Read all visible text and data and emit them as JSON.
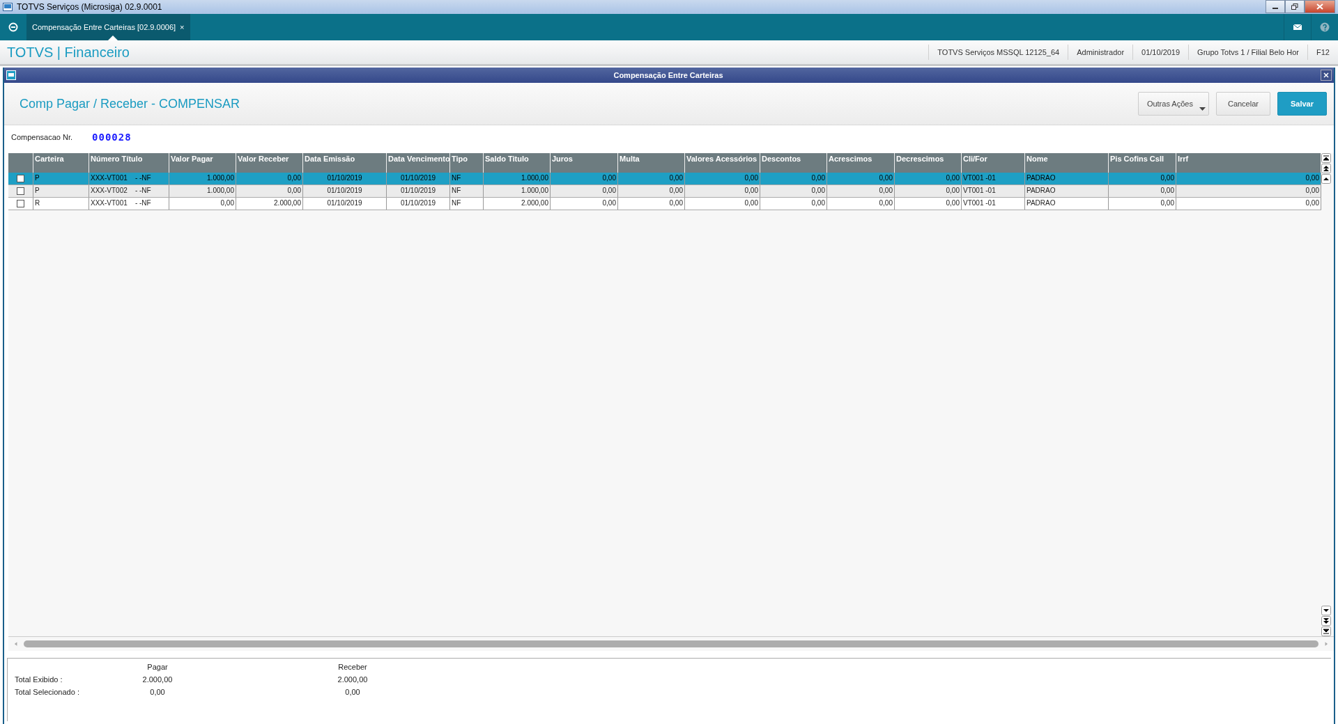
{
  "window": {
    "title": "TOTVS Serviços (Microsiga) 02.9.0001"
  },
  "tabs": [
    {
      "label": "Compensação Entre Carteiras [02.9.0006]",
      "close": "×",
      "selected": true
    }
  ],
  "header": {
    "brand": "TOTVS | Financeiro",
    "status": [
      "TOTVS Serviços MSSQL 12125_64",
      "Administrador",
      "01/10/2019",
      "Grupo Totvs 1 / Filial Belo Hor",
      "F12"
    ]
  },
  "dialog": {
    "title": "Compensação Entre Carteiras",
    "form_title": "Comp Pagar / Receber - COMPENSAR",
    "buttons": [
      {
        "label": "Outras Ações",
        "kind": "menu"
      },
      {
        "label": "Cancelar",
        "kind": "normal"
      },
      {
        "label": "Salvar",
        "kind": "primary"
      }
    ],
    "field": {
      "label": "Compensacao Nr.",
      "value": "000028"
    }
  },
  "table": {
    "columns": [
      "Carteira",
      "Número Título",
      "Valor Pagar",
      "Valor Receber",
      "Data Emissão",
      "Data Vencimento",
      "Tipo",
      "Saldo Titulo",
      "Juros",
      "Multa",
      "Valores Acessórios",
      "Descontos",
      "Acrescimos",
      "Decrescimos",
      "Cli/For",
      "Nome",
      "Pis Cofins Csll",
      "Irrf"
    ],
    "rows": [
      {
        "selected": true,
        "checked": false,
        "cells": [
          "P",
          "XXX-VT001    - -NF",
          "1.000,00",
          "0,00",
          "01/10/2019",
          "01/10/2019",
          "NF",
          "1.000,00",
          "0,00",
          "0,00",
          "0,00",
          "0,00",
          "0,00",
          "0,00",
          "VT001 -01",
          "PADRAO",
          "0,00",
          "0,00"
        ]
      },
      {
        "selected": false,
        "checked": false,
        "cells": [
          "P",
          "XXX-VT002    - -NF",
          "1.000,00",
          "0,00",
          "01/10/2019",
          "01/10/2019",
          "NF",
          "1.000,00",
          "0,00",
          "0,00",
          "0,00",
          "0,00",
          "0,00",
          "0,00",
          "VT001 -01",
          "PADRAO",
          "0,00",
          "0,00"
        ]
      },
      {
        "selected": false,
        "checked": false,
        "cells": [
          "R",
          "XXX-VT001    - -NF",
          "0,00",
          "2.000,00",
          "01/10/2019",
          "01/10/2019",
          "NF",
          "2.000,00",
          "0,00",
          "0,00",
          "0,00",
          "0,00",
          "0,00",
          "0,00",
          "VT001 -01",
          "PADRAO",
          "0,00",
          "0,00"
        ]
      }
    ]
  },
  "totals": {
    "columns": [
      "Pagar",
      "Receber"
    ],
    "rows": [
      {
        "label": "Total Exibido :",
        "values": [
          "2.000,00",
          "2.000,00"
        ]
      },
      {
        "label": "Total Selecionado :",
        "values": [
          "0,00",
          "0,00"
        ]
      }
    ]
  }
}
